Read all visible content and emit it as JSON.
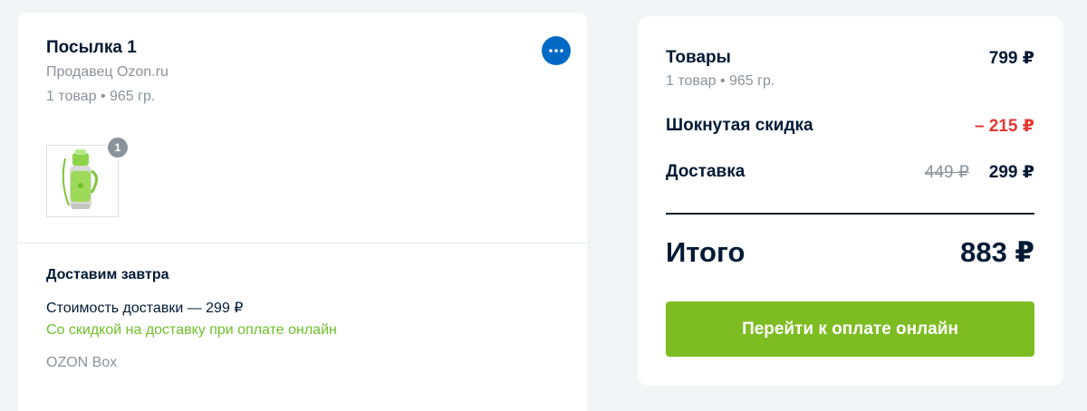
{
  "parcel": {
    "title": "Посылка 1",
    "seller": "Продавец Ozon.ru",
    "meta": "1 товар • 965 гр.",
    "item_quantity": "1",
    "product_colors": {
      "body": "#d8dcd6",
      "accent": "#8ed34a"
    }
  },
  "delivery": {
    "title": "Доставим завтра",
    "cost": "Стоимость доставки — 299 ₽",
    "discount_note": "Со скидкой на доставку при оплате онлайн",
    "method": "OZON Box"
  },
  "summary": {
    "goods_label": "Товары",
    "goods_value": "799 ₽",
    "goods_meta": "1 товар • 965 гр.",
    "discount_label": "Шокнутая скидка",
    "discount_value": "– 215 ₽",
    "shipping_label": "Доставка",
    "shipping_old_value": "449 ₽",
    "shipping_value": "299 ₽",
    "total_label": "Итого",
    "total_value": "883 ₽",
    "pay_button_label": "Перейти к оплате онлайн"
  },
  "colors": {
    "accent_green": "#7ebd22",
    "discount_red": "#e53935",
    "link_green": "#6fc02a",
    "more_button_blue": "#0069c6",
    "muted_text": "#8a939c"
  },
  "icons": {
    "more": "more-dots-icon"
  }
}
